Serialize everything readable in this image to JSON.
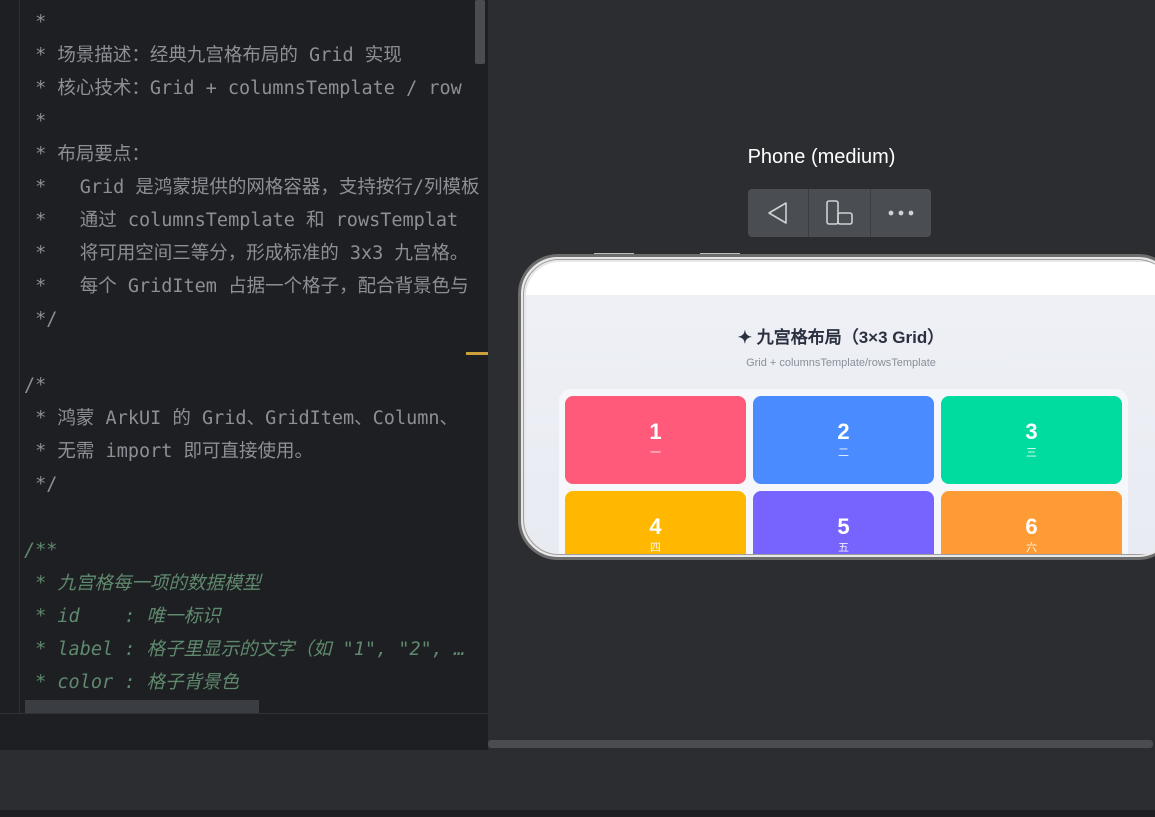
{
  "editor": {
    "lines": [
      {
        "text": " *",
        "style": "comment"
      },
      {
        "text": " * 场景描述：经典九宫格布局的 Grid 实现",
        "style": "comment"
      },
      {
        "text": " * 核心技术：Grid + columnsTemplate / row",
        "style": "comment"
      },
      {
        "text": " *",
        "style": "comment"
      },
      {
        "text": " * 布局要点：",
        "style": "comment"
      },
      {
        "text": " *   Grid 是鸿蒙提供的网格容器，支持按行/列模板",
        "style": "comment"
      },
      {
        "text": " *   通过 columnsTemplate 和 rowsTemplat",
        "style": "comment"
      },
      {
        "text": " *   将可用空间三等分，形成标准的 3x3 九宫格。",
        "style": "comment"
      },
      {
        "text": " *   每个 GridItem 占据一个格子，配合背景色与",
        "style": "comment"
      },
      {
        "text": " */",
        "style": "comment"
      },
      {
        "text": "",
        "style": "comment"
      },
      {
        "text": "/*",
        "style": "comment"
      },
      {
        "text": " * 鸿蒙 ArkUI 的 Grid、GridItem、Column、",
        "style": "comment"
      },
      {
        "text": " * 无需 import 即可直接使用。",
        "style": "comment"
      },
      {
        "text": " */",
        "style": "comment"
      },
      {
        "text": "",
        "style": "comment"
      },
      {
        "text": "/**",
        "style": "doc"
      },
      {
        "text": " * 九宫格每一项的数据模型",
        "style": "doc"
      },
      {
        "text": " * id    : 唯一标识",
        "style": "doc"
      },
      {
        "text": " * label : 格子里显示的文字（如 \"1\", \"2\", …",
        "style": "doc"
      },
      {
        "text": " * color : 格子背景色",
        "style": "doc"
      },
      {
        "text": " */",
        "style": "doc"
      }
    ]
  },
  "preview": {
    "device_title": "Phone (medium)",
    "toolbar": {
      "back_icon": "triangle-left-icon",
      "rotate_icon": "device-rotate-icon",
      "more_icon": "more-horizontal-icon"
    },
    "app": {
      "title": "✦ 九宫格布局（3×3 Grid）",
      "subtitle": "Grid + columnsTemplate/rowsTemplate",
      "cells": [
        {
          "num": "1",
          "sub": "一",
          "color": "#ff5a79"
        },
        {
          "num": "2",
          "sub": "二",
          "color": "#4a8cff"
        },
        {
          "num": "3",
          "sub": "三",
          "color": "#00dba0"
        },
        {
          "num": "4",
          "sub": "四",
          "color": "#ffb700"
        },
        {
          "num": "5",
          "sub": "五",
          "color": "#7764ff"
        },
        {
          "num": "6",
          "sub": "六",
          "color": "#ff9b34"
        }
      ]
    }
  },
  "colors": {
    "editor_bg": "#1e1f22",
    "ide_bg": "#2b2d30",
    "comment": "#8c8f95",
    "doc_comment": "#5f8a6e"
  }
}
